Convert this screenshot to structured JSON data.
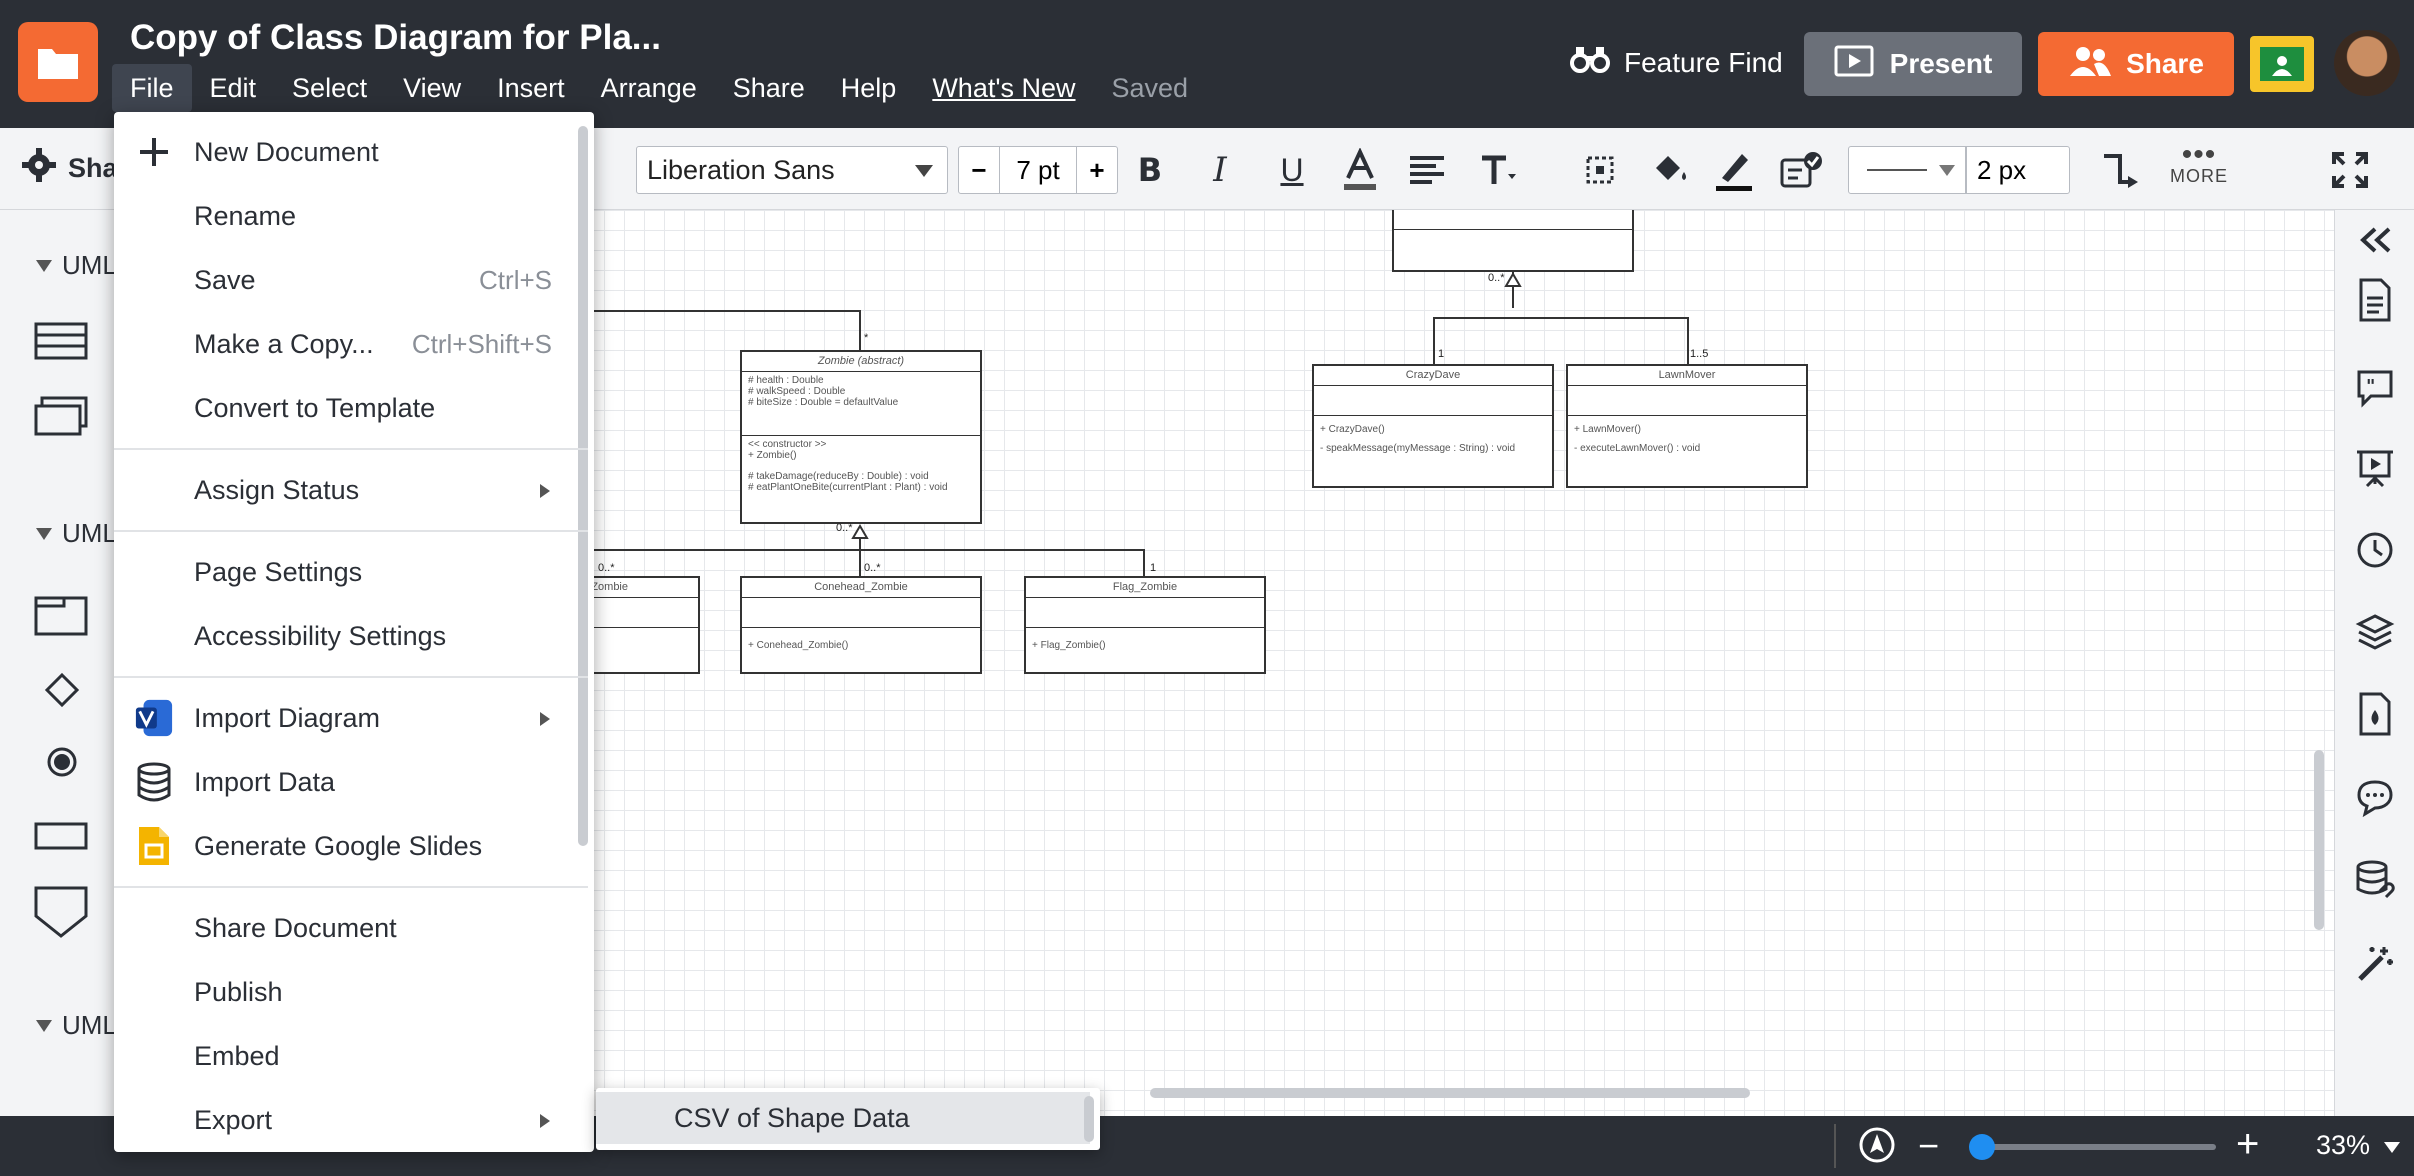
{
  "app": {
    "doc_title": "Copy of Class Diagram for Pla...",
    "menu": [
      "File",
      "Edit",
      "Select",
      "View",
      "Insert",
      "Arrange",
      "Share",
      "Help",
      "What's New",
      "Saved"
    ]
  },
  "header": {
    "feature_find": "Feature Find",
    "present": "Present",
    "share": "Share"
  },
  "toolbar": {
    "shapes_label": "Sha",
    "font": "Liberation Sans",
    "font_size": "7 pt",
    "line_width": "2 px",
    "more": "MORE",
    "minus": "−",
    "plus": "+"
  },
  "leftpanel": {
    "section1": "UML",
    "section2": "UML",
    "section3": "UML"
  },
  "file_menu": {
    "items": [
      {
        "label": "New Document",
        "shortcut": "",
        "icon": "plus-icon"
      },
      {
        "label": "Rename",
        "shortcut": ""
      },
      {
        "label": "Save",
        "shortcut": "Ctrl+S"
      },
      {
        "label": "Make a Copy...",
        "shortcut": "Ctrl+Shift+S"
      },
      {
        "label": "Convert to Template",
        "shortcut": ""
      },
      {
        "label": "Assign Status",
        "submenu": true
      },
      {
        "label": "Page Settings"
      },
      {
        "label": "Accessibility Settings"
      },
      {
        "label": "Import Diagram",
        "submenu": true,
        "icon": "visio-icon"
      },
      {
        "label": "Import Data",
        "icon": "database-icon"
      },
      {
        "label": "Generate Google Slides",
        "icon": "google-slides-icon"
      },
      {
        "label": "Share Document"
      },
      {
        "label": "Publish"
      },
      {
        "label": "Embed"
      },
      {
        "label": "Export",
        "submenu": true
      }
    ],
    "submenu_item": "CSV of Shape Data"
  },
  "diagram": {
    "zombie": {
      "title": "Zombie (abstract)",
      "attrs": [
        "# health : Double",
        "# walkSpeed : Double",
        "# biteSize : Double = defaultValue"
      ],
      "methods": [
        "<< constructor >>",
        "+ Zombie()",
        "",
        "# takeDamage(reduceBy : Double) : void",
        "# eatPlantOneBite(currentPlant : Plant) : void"
      ]
    },
    "zombie_basic": {
      "title": "Zombie"
    },
    "conehead": {
      "title": "Conehead_Zombie",
      "method": "+ Conehead_Zombie()"
    },
    "flag": {
      "title": "Flag_Zombie",
      "method": "+ Flag_Zombie()"
    },
    "crazydave": {
      "title": "CrazyDave",
      "methods": [
        "+ CrazyDave()",
        "- speakMessage(myMessage : String) : void"
      ]
    },
    "lawnmover": {
      "title": "LawnMover",
      "methods": [
        "+ LawnMover()",
        "- executeLawnMover() : void"
      ]
    },
    "labels": {
      "star": "*",
      "m1": "0..*",
      "m2": "0..*",
      "m3": "0..*",
      "m4": "1",
      "m5": "0..*",
      "m6": "1",
      "m7": "1..5"
    }
  },
  "bottombar": {
    "zoom": "33%",
    "zoom_fraction": 0.33
  },
  "colors": {
    "accent": "#f46a33",
    "header_bg": "#2b2f36",
    "zoom_knob": "#1f8ef1"
  }
}
